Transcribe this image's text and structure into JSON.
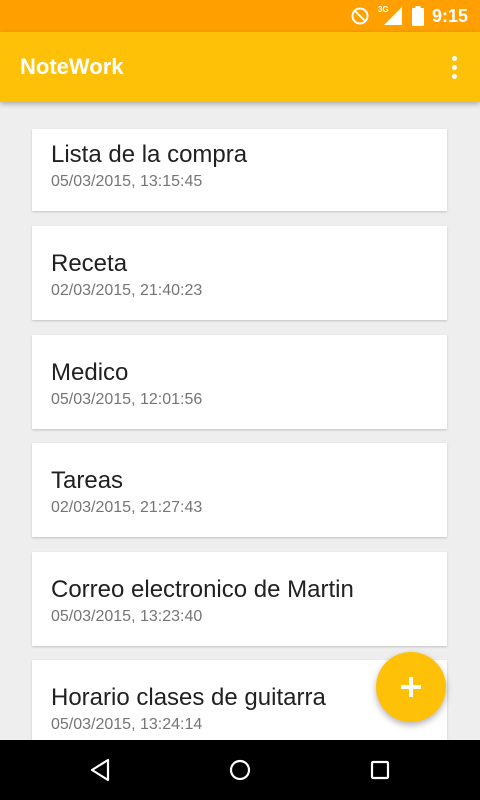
{
  "status_bar": {
    "time": "9:15",
    "network_label": "3G",
    "icons": [
      "do-not-disturb-icon",
      "signal-icon",
      "battery-icon"
    ]
  },
  "app_bar": {
    "title": "NoteWork",
    "overflow_icon": "more-vert-icon"
  },
  "notes": [
    {
      "title": "Lista de la compra",
      "date": "05/03/2015, 13:15:45"
    },
    {
      "title": "Receta",
      "date": "02/03/2015, 21:40:23"
    },
    {
      "title": "Medico",
      "date": "05/03/2015, 12:01:56"
    },
    {
      "title": "Tareas",
      "date": "02/03/2015, 21:27:43"
    },
    {
      "title": "Correo electronico de Martin",
      "date": "05/03/2015, 13:23:40"
    },
    {
      "title": "Horario clases de guitarra",
      "date": "05/03/2015, 13:24:14"
    }
  ],
  "fab": {
    "icon": "add-icon"
  },
  "nav_bar": {
    "icons": [
      "back-icon",
      "home-icon",
      "recents-icon"
    ]
  },
  "colors": {
    "primary": "#FFC107",
    "primary_dark": "#FFA000",
    "background": "#EEEEEE"
  }
}
